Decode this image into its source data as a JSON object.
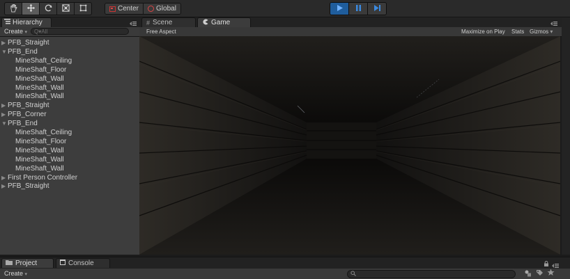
{
  "toolbar": {
    "tools": [
      {
        "icon": "hand-icon"
      },
      {
        "icon": "move-icon"
      },
      {
        "icon": "rotate-icon"
      },
      {
        "icon": "scale-icon"
      },
      {
        "icon": "rect-tool-icon"
      }
    ],
    "pivot_label": "Center",
    "space_label": "Global",
    "play_icons": [
      "play-icon",
      "pause-icon",
      "step-icon"
    ],
    "accent": "#3b8ae0"
  },
  "hierarchy": {
    "tab_label": "Hierarchy",
    "create_label": "Create",
    "search_placeholder": "Q▾All",
    "items": [
      {
        "label": "PFB_Straight",
        "depth": 0,
        "arrow": "▶"
      },
      {
        "label": "PFB_End",
        "depth": 0,
        "arrow": "▼"
      },
      {
        "label": "MineShaft_Ceiling",
        "depth": 1,
        "arrow": ""
      },
      {
        "label": "MineShaft_Floor",
        "depth": 1,
        "arrow": ""
      },
      {
        "label": "MineShaft_Wall",
        "depth": 1,
        "arrow": ""
      },
      {
        "label": "MineShaft_Wall",
        "depth": 1,
        "arrow": ""
      },
      {
        "label": "MineShaft_Wall",
        "depth": 1,
        "arrow": ""
      },
      {
        "label": "PFB_Straight",
        "depth": 0,
        "arrow": "▶"
      },
      {
        "label": "PFB_Corner",
        "depth": 0,
        "arrow": "▶"
      },
      {
        "label": "PFB_End",
        "depth": 0,
        "arrow": "▼"
      },
      {
        "label": "MineShaft_Ceiling",
        "depth": 1,
        "arrow": ""
      },
      {
        "label": "MineShaft_Floor",
        "depth": 1,
        "arrow": ""
      },
      {
        "label": "MineShaft_Wall",
        "depth": 1,
        "arrow": ""
      },
      {
        "label": "MineShaft_Wall",
        "depth": 1,
        "arrow": ""
      },
      {
        "label": "MineShaft_Wall",
        "depth": 1,
        "arrow": ""
      },
      {
        "label": "First Person Controller",
        "depth": 0,
        "arrow": "▶"
      },
      {
        "label": "PFB_Straight",
        "depth": 0,
        "arrow": "▶"
      }
    ]
  },
  "views": {
    "scene_tab": "Scene",
    "game_tab": "Game",
    "aspect_label": "Free Aspect",
    "maximize_label": "Maximize on Play",
    "stats_label": "Stats",
    "gizmos_label": "Gizmos"
  },
  "bottom": {
    "project_tab": "Project",
    "console_tab": "Console",
    "create_label": "Create"
  }
}
